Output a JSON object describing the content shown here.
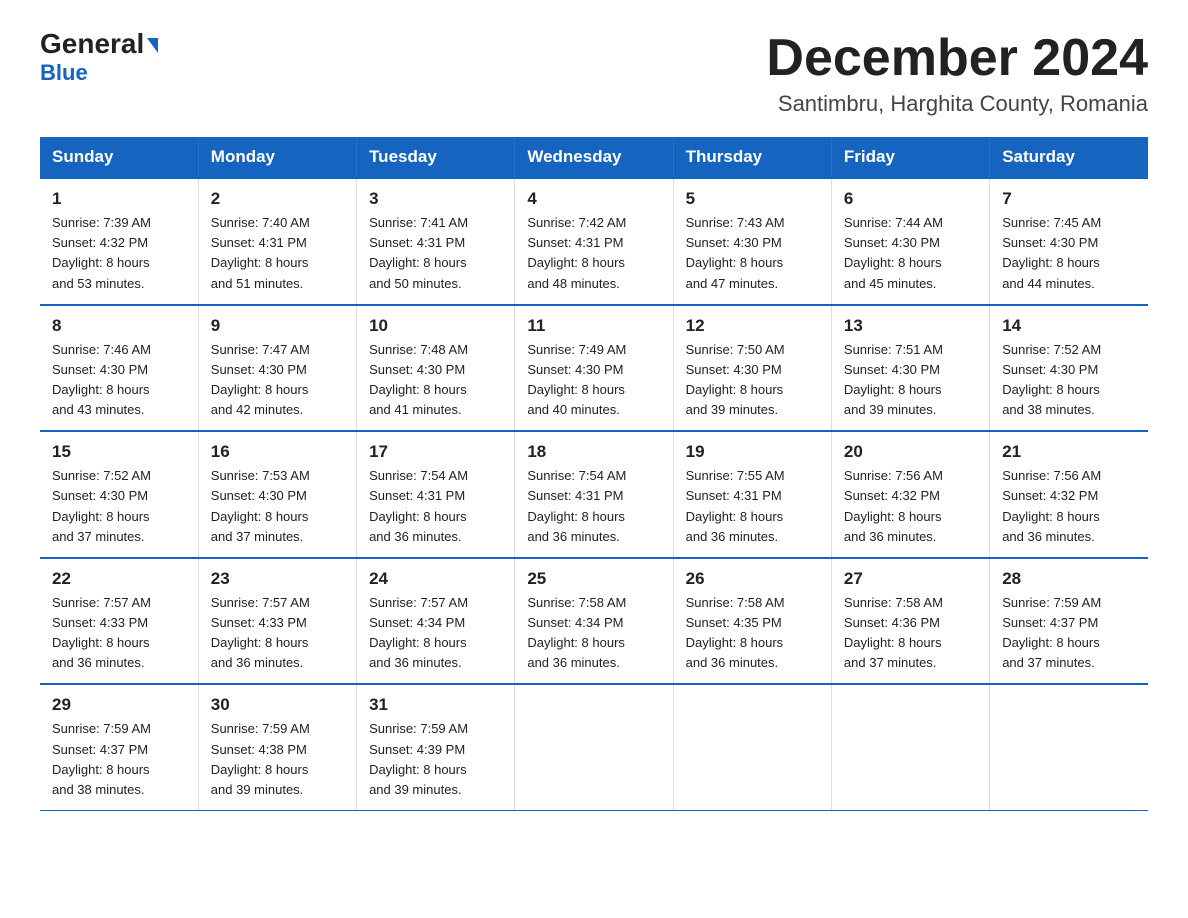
{
  "logo": {
    "general": "General",
    "blue": "Blue",
    "arrow": "▶"
  },
  "header": {
    "month_year": "December 2024",
    "location": "Santimbru, Harghita County, Romania"
  },
  "weekdays": [
    "Sunday",
    "Monday",
    "Tuesday",
    "Wednesday",
    "Thursday",
    "Friday",
    "Saturday"
  ],
  "weeks": [
    [
      {
        "day": "1",
        "sunrise": "7:39 AM",
        "sunset": "4:32 PM",
        "daylight": "8 hours and 53 minutes."
      },
      {
        "day": "2",
        "sunrise": "7:40 AM",
        "sunset": "4:31 PM",
        "daylight": "8 hours and 51 minutes."
      },
      {
        "day": "3",
        "sunrise": "7:41 AM",
        "sunset": "4:31 PM",
        "daylight": "8 hours and 50 minutes."
      },
      {
        "day": "4",
        "sunrise": "7:42 AM",
        "sunset": "4:31 PM",
        "daylight": "8 hours and 48 minutes."
      },
      {
        "day": "5",
        "sunrise": "7:43 AM",
        "sunset": "4:30 PM",
        "daylight": "8 hours and 47 minutes."
      },
      {
        "day": "6",
        "sunrise": "7:44 AM",
        "sunset": "4:30 PM",
        "daylight": "8 hours and 45 minutes."
      },
      {
        "day": "7",
        "sunrise": "7:45 AM",
        "sunset": "4:30 PM",
        "daylight": "8 hours and 44 minutes."
      }
    ],
    [
      {
        "day": "8",
        "sunrise": "7:46 AM",
        "sunset": "4:30 PM",
        "daylight": "8 hours and 43 minutes."
      },
      {
        "day": "9",
        "sunrise": "7:47 AM",
        "sunset": "4:30 PM",
        "daylight": "8 hours and 42 minutes."
      },
      {
        "day": "10",
        "sunrise": "7:48 AM",
        "sunset": "4:30 PM",
        "daylight": "8 hours and 41 minutes."
      },
      {
        "day": "11",
        "sunrise": "7:49 AM",
        "sunset": "4:30 PM",
        "daylight": "8 hours and 40 minutes."
      },
      {
        "day": "12",
        "sunrise": "7:50 AM",
        "sunset": "4:30 PM",
        "daylight": "8 hours and 39 minutes."
      },
      {
        "day": "13",
        "sunrise": "7:51 AM",
        "sunset": "4:30 PM",
        "daylight": "8 hours and 39 minutes."
      },
      {
        "day": "14",
        "sunrise": "7:52 AM",
        "sunset": "4:30 PM",
        "daylight": "8 hours and 38 minutes."
      }
    ],
    [
      {
        "day": "15",
        "sunrise": "7:52 AM",
        "sunset": "4:30 PM",
        "daylight": "8 hours and 37 minutes."
      },
      {
        "day": "16",
        "sunrise": "7:53 AM",
        "sunset": "4:30 PM",
        "daylight": "8 hours and 37 minutes."
      },
      {
        "day": "17",
        "sunrise": "7:54 AM",
        "sunset": "4:31 PM",
        "daylight": "8 hours and 36 minutes."
      },
      {
        "day": "18",
        "sunrise": "7:54 AM",
        "sunset": "4:31 PM",
        "daylight": "8 hours and 36 minutes."
      },
      {
        "day": "19",
        "sunrise": "7:55 AM",
        "sunset": "4:31 PM",
        "daylight": "8 hours and 36 minutes."
      },
      {
        "day": "20",
        "sunrise": "7:56 AM",
        "sunset": "4:32 PM",
        "daylight": "8 hours and 36 minutes."
      },
      {
        "day": "21",
        "sunrise": "7:56 AM",
        "sunset": "4:32 PM",
        "daylight": "8 hours and 36 minutes."
      }
    ],
    [
      {
        "day": "22",
        "sunrise": "7:57 AM",
        "sunset": "4:33 PM",
        "daylight": "8 hours and 36 minutes."
      },
      {
        "day": "23",
        "sunrise": "7:57 AM",
        "sunset": "4:33 PM",
        "daylight": "8 hours and 36 minutes."
      },
      {
        "day": "24",
        "sunrise": "7:57 AM",
        "sunset": "4:34 PM",
        "daylight": "8 hours and 36 minutes."
      },
      {
        "day": "25",
        "sunrise": "7:58 AM",
        "sunset": "4:34 PM",
        "daylight": "8 hours and 36 minutes."
      },
      {
        "day": "26",
        "sunrise": "7:58 AM",
        "sunset": "4:35 PM",
        "daylight": "8 hours and 36 minutes."
      },
      {
        "day": "27",
        "sunrise": "7:58 AM",
        "sunset": "4:36 PM",
        "daylight": "8 hours and 37 minutes."
      },
      {
        "day": "28",
        "sunrise": "7:59 AM",
        "sunset": "4:37 PM",
        "daylight": "8 hours and 37 minutes."
      }
    ],
    [
      {
        "day": "29",
        "sunrise": "7:59 AM",
        "sunset": "4:37 PM",
        "daylight": "8 hours and 38 minutes."
      },
      {
        "day": "30",
        "sunrise": "7:59 AM",
        "sunset": "4:38 PM",
        "daylight": "8 hours and 39 minutes."
      },
      {
        "day": "31",
        "sunrise": "7:59 AM",
        "sunset": "4:39 PM",
        "daylight": "8 hours and 39 minutes."
      },
      {
        "day": "",
        "sunrise": "",
        "sunset": "",
        "daylight": ""
      },
      {
        "day": "",
        "sunrise": "",
        "sunset": "",
        "daylight": ""
      },
      {
        "day": "",
        "sunrise": "",
        "sunset": "",
        "daylight": ""
      },
      {
        "day": "",
        "sunrise": "",
        "sunset": "",
        "daylight": ""
      }
    ]
  ]
}
